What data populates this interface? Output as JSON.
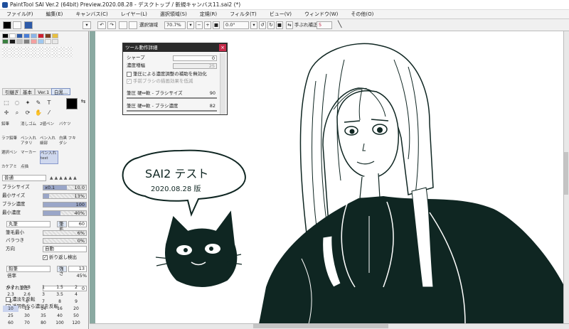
{
  "window": {
    "title": "PaintTool SAI Ver.2 (64bit) Preview.2020.08.28 - デスクトップ / 新規キャンバス11.sai2 (*)"
  },
  "menu": [
    "ファイル(F)",
    "編集(E)",
    "キャンバス(C)",
    "レイヤー(L)",
    "選択領域(S)",
    "定規(R)",
    "フィルタ(T)",
    "ビュー(V)",
    "ウィンドウ(W)",
    "その他(O)"
  ],
  "toolbar": {
    "selection_label": "選択領域",
    "zoom": "70.7%",
    "angle": "0.0°",
    "stabilizer_label": "手ぶれ補正",
    "stabilizer_value": "5"
  },
  "colors": {
    "swatches": [
      "#000000",
      "#ffffff",
      "#2d5aa8",
      "#4a7ed8",
      "#8ab4e8",
      "#d02030",
      "#7a4020",
      "#e8c040",
      "#3a8040",
      "#1a1a1a",
      "#c0c0c0",
      "#808080",
      "#f4a0a0",
      "#a0c8f0",
      "#f0f0f0",
      "#e8e8e8"
    ],
    "primary": "#000000",
    "canvas_bg": "#8aa9a1",
    "ink": "#0f2622"
  },
  "panel_tabs": [
    "引継ぎ",
    "基本",
    "Ver.1",
    "白黒..."
  ],
  "tools": [
    {
      "label": "鉛筆",
      "sel": false
    },
    {
      "label": "消しゴム",
      "sel": false
    },
    {
      "label": "2値ペン",
      "sel": false
    },
    {
      "label": "バケツ",
      "sel": false
    },
    {
      "label": "ラフ鉛筆",
      "sel": false
    },
    {
      "label": "ペン入れ アタリ",
      "sel": false
    },
    {
      "label": "ペン入れ 細部",
      "sel": false
    },
    {
      "label": "白黒 フキダシ",
      "sel": false
    },
    {
      "label": "選択ペン",
      "sel": false
    },
    {
      "label": "マーカー",
      "sel": false
    },
    {
      "label": "ペン入れ test",
      "sel": true
    },
    {
      "label": "",
      "sel": false
    },
    {
      "label": "カケアミ",
      "sel": false
    },
    {
      "label": "点描",
      "sel": false
    }
  ],
  "brush": {
    "mode": "普通",
    "size_label": "ブラシサイズ",
    "size_mult": "x0.1",
    "size_value": "10.0",
    "size_pct": 0.55,
    "min_size_label": "最小サイズ",
    "min_size_value": "13%",
    "min_size_pct": 0.13,
    "density_label": "ブラシ濃度",
    "density_value": "100",
    "density_pct": 1.0,
    "min_density_label": "最小濃度",
    "min_density_value": "40%",
    "min_density_pct": 0.4
  },
  "shape": {
    "name": "丸筆",
    "tag": "筆毛",
    "value": "60",
    "bristle_min_label": "筆毛最小",
    "bristle_min_value": "6%",
    "variation_label": "バラつき",
    "variation_value": "0%",
    "direction_label": "方向",
    "direction_value": "自動",
    "fold_label": "折り返し検出"
  },
  "texture": {
    "name": "鉛筆",
    "tag": "強さ",
    "value": "13",
    "ratio_label": "倍率",
    "ratio_value": "45%",
    "blur_label": "かすれ筆圧",
    "blur_value": "0",
    "invert_label": "濃淡を反転",
    "transparent_label": "透明色なら濃淡を反転"
  },
  "size_grid": [
    "0.7",
    "0.8",
    "1",
    "1.5",
    "2",
    "2.3",
    "2.6",
    "3",
    "3.5",
    "4",
    "5",
    "6",
    "7",
    "8",
    "9",
    "10",
    "12",
    "14",
    "16",
    "20",
    "25",
    "30",
    "35",
    "40",
    "50",
    "60",
    "70",
    "80",
    "100",
    "120"
  ],
  "size_grid_selected": "10",
  "dialog": {
    "title": "ツール動作詳細",
    "sharp_label": "シャープ",
    "sharp_value": "0",
    "density_label": "濃度増幅",
    "density_value": "25",
    "check1": "筆圧による濃度調整の補助を無効化",
    "check2": "手前ブラシの描画効果を低減",
    "curve1_label": "筆圧 硬⇔軟 - ブラシサイズ",
    "curve1_value": "90",
    "curve2_label": "筆圧 硬⇔軟 - ブラシ濃度",
    "curve2_value": "82"
  },
  "artwork": {
    "bubble_line1": "SAI2 テスト",
    "bubble_line2": "2020.08.28 版"
  }
}
